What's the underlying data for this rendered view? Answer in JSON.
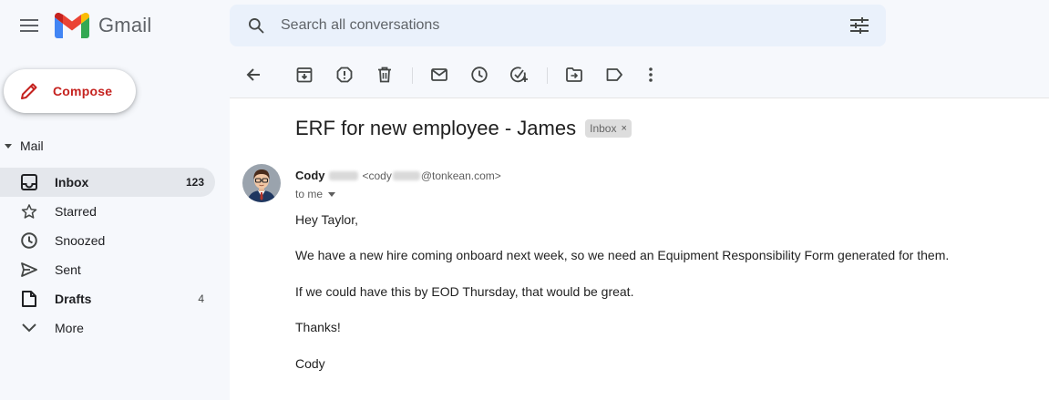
{
  "app": {
    "name": "Gmail"
  },
  "search": {
    "placeholder": "Search all conversations"
  },
  "compose": {
    "label": "Compose"
  },
  "sidebar": {
    "section_label": "Mail",
    "items": [
      {
        "label": "Inbox",
        "count": "123"
      },
      {
        "label": "Starred",
        "count": ""
      },
      {
        "label": "Snoozed",
        "count": ""
      },
      {
        "label": "Sent",
        "count": ""
      },
      {
        "label": "Drafts",
        "count": "4"
      },
      {
        "label": "More",
        "count": ""
      }
    ]
  },
  "toolbar": {
    "icons": [
      "back-arrow-icon",
      "archive-icon",
      "report-spam-icon",
      "delete-icon",
      "mark-unread-icon",
      "snooze-icon",
      "add-task-icon",
      "move-to-icon",
      "label-icon",
      "more-vert-icon"
    ]
  },
  "email": {
    "subject": "ERF for new employee - James",
    "label_chip": "Inbox",
    "label_chip_close": "×",
    "sender_name": "Cody",
    "sender_email_prefix": "<cody",
    "sender_email_domain": "@tonkean.com>",
    "to_line": "to me",
    "body": {
      "greeting": "Hey Taylor,",
      "p1": "We have a new hire coming onboard next week, so we need an Equipment Responsibility Form generated for them.",
      "p2": "If we could have this by EOD Thursday, that would be great.",
      "thanks": "Thanks!",
      "signature": "Cody"
    }
  },
  "colors": {
    "accent_red": "#c5221f",
    "bg": "#f6f8fc",
    "search_bg": "#eaf1fb",
    "active_nav": "#e4e7ec"
  }
}
